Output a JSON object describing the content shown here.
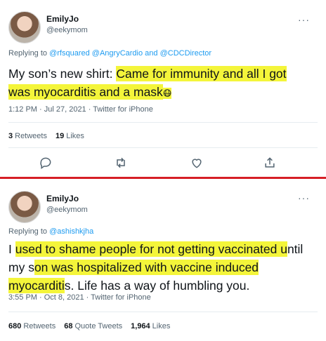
{
  "tweet1": {
    "name": "EmilyJo",
    "handle": "@eekymom",
    "more": "···",
    "replying_prefix": "Replying to ",
    "replying_users": [
      "@rfsquared",
      "@AngryCardio",
      "@CDCDirector"
    ],
    "replying_and": " and ",
    "text_line1_a": "My son’s new shirt: ",
    "text_line1_hl": "Came for immunity and all I got",
    "text_line2_hl": "was myocarditis and a mask",
    "emoji": "😷",
    "timestamp": "1:12 PM · Jul 27, 2021 · Twitter for iPhone",
    "retweets_count": "3",
    "retweets_label": "Retweets",
    "likes_count": "19",
    "likes_label": "Likes"
  },
  "tweet2": {
    "name": "EmilyJo",
    "handle": "@eekymom",
    "more": "···",
    "replying_prefix": "Replying to ",
    "replying_user": "@ashishkjha",
    "line1_a": "I ",
    "line1_hl": "used to shame people for not getting vaccinated u",
    "line1_b": "ntil",
    "line2_a": "my s",
    "line2_hl": "on was hospitalized with vaccine induced",
    "line3_hl": "myocarditi",
    "line3_b": "s. Life has a way of humbling you.",
    "timestamp": "3:55 PM · Oct 8, 2021 · Twitter for iPhone",
    "retweets_count": "680",
    "retweets_label": "Retweets",
    "quotes_count": "68",
    "quotes_label": "Quote Tweets",
    "likes_count": "1,964",
    "likes_label": "Likes"
  },
  "icons": [
    "reply-icon",
    "retweet-icon",
    "like-icon",
    "share-icon"
  ],
  "colors": {
    "highlight": "#f4f53a",
    "divider": "#d61f26",
    "link": "#1d9bf0"
  }
}
